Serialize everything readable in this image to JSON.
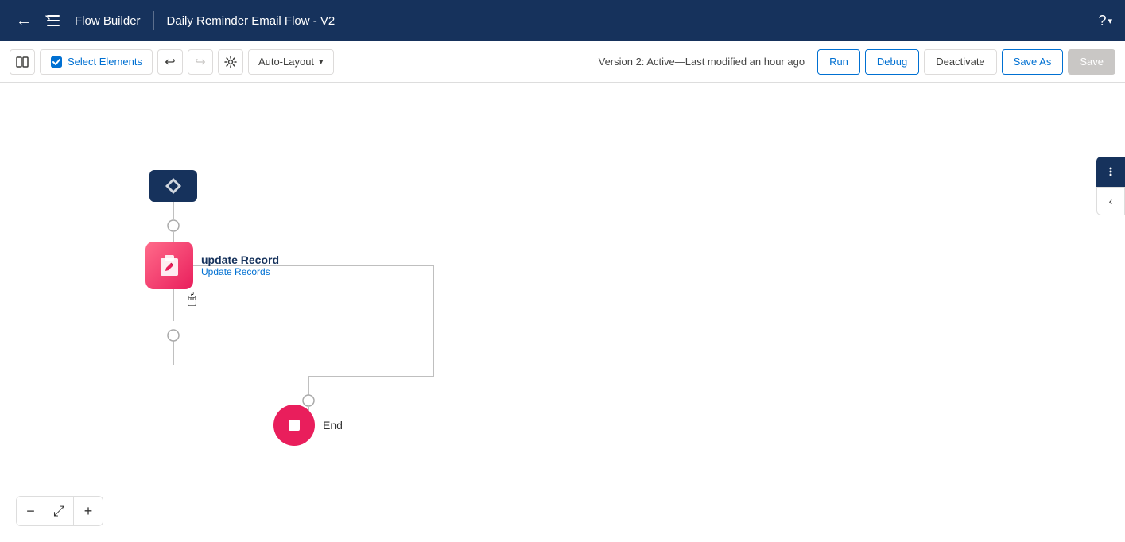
{
  "nav": {
    "back_label": "←",
    "logo_symbol": "≡",
    "app_name": "Flow Builder",
    "flow_title": "Daily Reminder Email Flow - V2",
    "help_label": "?"
  },
  "toolbar": {
    "toggle_panel_label": "",
    "select_elements_label": "Select Elements",
    "undo_label": "↩",
    "redo_label": "↪",
    "settings_label": "⚙",
    "auto_layout_label": "Auto-Layout",
    "auto_layout_arrow": "▾",
    "version_status": "Version 2: Active",
    "version_modified": "Last modified an hour ago",
    "run_label": "Run",
    "debug_label": "Debug",
    "deactivate_label": "Deactivate",
    "save_as_label": "Save As",
    "save_label": "Save"
  },
  "canvas": {
    "update_node": {
      "title": "update Record",
      "subtitle": "Update Records"
    },
    "end_node": {
      "label": "End"
    }
  },
  "zoom": {
    "minus": "−",
    "fit": "⤢",
    "plus": "+"
  }
}
